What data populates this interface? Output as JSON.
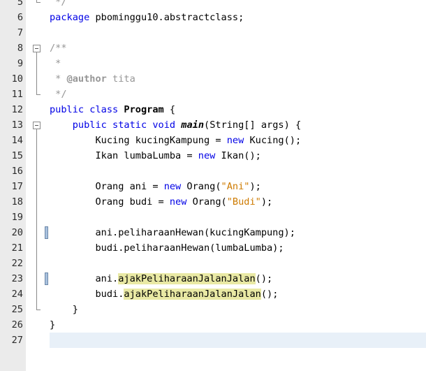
{
  "editor": {
    "lines": [
      {
        "n": "5",
        "html": "<span class=\"cm\"> */</span>"
      },
      {
        "n": "6",
        "html": "<span class=\"kw\">package</span> pbominggu10.abstractclass;"
      },
      {
        "n": "7",
        "html": ""
      },
      {
        "n": "8",
        "html": "<span class=\"cm\">/**</span>"
      },
      {
        "n": "9",
        "html": "<span class=\"cm\"> *</span>"
      },
      {
        "n": "10",
        "html": "<span class=\"cm\"> * </span><span class=\"tag\">@author</span><span class=\"cm\"> tita</span>"
      },
      {
        "n": "11",
        "html": "<span class=\"cm\"> */</span>"
      },
      {
        "n": "12",
        "html": "<span class=\"kw\">public class</span> <span class=\"cls\">Program</span> {"
      },
      {
        "n": "13",
        "html": "    <span class=\"kw\">public static void</span> <span class=\"mth\">main</span>(String[] args) {"
      },
      {
        "n": "14",
        "html": "        Kucing kucingKampung = <span class=\"kw\">new</span> Kucing();"
      },
      {
        "n": "15",
        "html": "        Ikan lumbaLumba = <span class=\"kw\">new</span> Ikan();"
      },
      {
        "n": "16",
        "html": ""
      },
      {
        "n": "17",
        "html": "        Orang ani = <span class=\"kw\">new</span> Orang(<span class=\"str\">\"Ani\"</span>);"
      },
      {
        "n": "18",
        "html": "        Orang budi = <span class=\"kw\">new</span> Orang(<span class=\"str\">\"Budi\"</span>);"
      },
      {
        "n": "19",
        "html": ""
      },
      {
        "n": "20",
        "html": "        ani.peliharaanHewan(kucingKampung);"
      },
      {
        "n": "21",
        "html": "        budi.peliharaanHewan(lumbaLumba);"
      },
      {
        "n": "22",
        "html": ""
      },
      {
        "n": "23",
        "html": "        ani.<span class=\"hl\">ajakPeliharaanJalanJalan</span>();"
      },
      {
        "n": "24",
        "html": "        budi.<span class=\"hl\">ajakPeliharaanJalanJalan</span>();"
      },
      {
        "n": "25",
        "html": "    }"
      },
      {
        "n": "26",
        "html": "}"
      },
      {
        "n": "27",
        "html": ""
      }
    ],
    "colors": {
      "keyword": "#0000e6",
      "string": "#ce7b00",
      "comment": "#969696",
      "highlight": "#e9e9a4",
      "current_line": "#e8f0f8"
    }
  }
}
